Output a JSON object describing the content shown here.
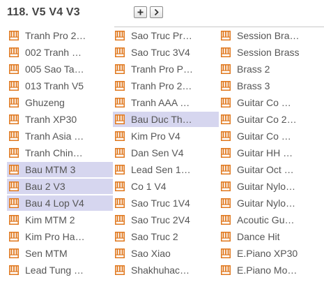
{
  "header": {
    "title": "118. V5 V4 V3"
  },
  "columns": [
    [
      {
        "label": "Tranh Pro 2…",
        "selected": false
      },
      {
        "label": "002 Tranh …",
        "selected": false
      },
      {
        "label": "005 Sao Ta…",
        "selected": false
      },
      {
        "label": "013 Tranh V5",
        "selected": false
      },
      {
        "label": "Ghuzeng",
        "selected": false
      },
      {
        "label": "Tranh XP30",
        "selected": false
      },
      {
        "label": "Tranh Asia …",
        "selected": false
      },
      {
        "label": "Tranh Chin…",
        "selected": false
      },
      {
        "label": "Bau MTM 3",
        "selected": true
      },
      {
        "label": "Bau 2 V3",
        "selected": true
      },
      {
        "label": "Bau 4 Lop V4",
        "selected": true
      },
      {
        "label": "Kim MTM 2",
        "selected": false
      },
      {
        "label": "Kim Pro Ha…",
        "selected": false
      },
      {
        "label": "Sen MTM",
        "selected": false
      },
      {
        "label": "Lead Tung …",
        "selected": false
      }
    ],
    [
      {
        "label": "Sao Truc Pr…",
        "selected": false
      },
      {
        "label": "Sao Truc 3V4",
        "selected": false
      },
      {
        "label": "Tranh Pro P…",
        "selected": false
      },
      {
        "label": "Tranh Pro 2…",
        "selected": false
      },
      {
        "label": "Tranh AAA …",
        "selected": false
      },
      {
        "label": "Bau Duc Th…",
        "selected": true
      },
      {
        "label": "Kim Pro V4",
        "selected": false
      },
      {
        "label": "Dan Sen V4",
        "selected": false
      },
      {
        "label": "Lead Sen 1…",
        "selected": false
      },
      {
        "label": "Co 1 V4",
        "selected": false
      },
      {
        "label": "Sao Truc 1V4",
        "selected": false
      },
      {
        "label": "Sao Truc 2V4",
        "selected": false
      },
      {
        "label": "Sao Truc 2",
        "selected": false
      },
      {
        "label": "Sao Xiao",
        "selected": false
      },
      {
        "label": "Shakhuhac…",
        "selected": false
      }
    ],
    [
      {
        "label": "Session Bra…",
        "selected": false
      },
      {
        "label": "Session Brass",
        "selected": false
      },
      {
        "label": "Brass 2",
        "selected": false
      },
      {
        "label": "Brass 3",
        "selected": false
      },
      {
        "label": "Guitar Co …",
        "selected": false
      },
      {
        "label": "Guitar Co 2…",
        "selected": false
      },
      {
        "label": "Guitar Co …",
        "selected": false
      },
      {
        "label": "Guitar HH …",
        "selected": false
      },
      {
        "label": "Guitar Oct …",
        "selected": false
      },
      {
        "label": "Guitar Nylo…",
        "selected": false
      },
      {
        "label": "Guitar Nylo…",
        "selected": false
      },
      {
        "label": "Acoutic Gu…",
        "selected": false
      },
      {
        "label": "Dance Hit",
        "selected": false
      },
      {
        "label": "E.Piano XP30",
        "selected": false
      },
      {
        "label": "E.Piano Mo…",
        "selected": false
      }
    ]
  ],
  "icons": {
    "item": "piano-keys-icon",
    "add": "plus-icon",
    "next": "chevron-right-icon"
  },
  "colors": {
    "icon": "#e0781e",
    "selected_bg": "#d6d6ef",
    "text": "#555555",
    "title": "#444444"
  }
}
